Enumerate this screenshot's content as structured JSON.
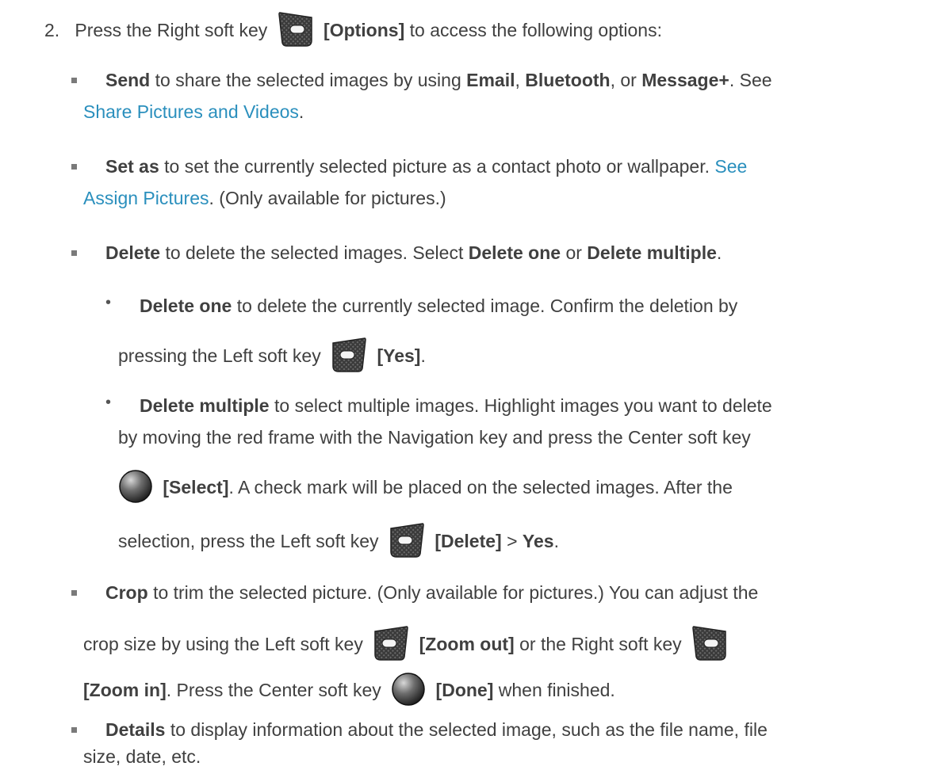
{
  "step": {
    "number": "2.",
    "t1": "Press the Right soft key",
    "label": "[Options]",
    "t2": "to access the following options:"
  },
  "send": {
    "label": "Send",
    "t1": "to share the selected images by using",
    "email": "Email",
    "t2": ",",
    "bluetooth": "Bluetooth",
    "t3": ", or",
    "message": "Message+",
    "t4": ". See",
    "link": "Share Pictures and Videos",
    "t5": "."
  },
  "setas": {
    "label": "Set as",
    "t1": "to set the currently selected picture as a contact photo or wallpaper.",
    "link1": "See",
    "link2": "Assign Pictures",
    "t2": ". (Only available for pictures.)"
  },
  "delete": {
    "label": "Delete",
    "t1": "to delete the selected images. Select",
    "one": "Delete one",
    "t2": "or",
    "multiple": "Delete multiple",
    "t3": "."
  },
  "delete_one": {
    "label": "Delete one",
    "t1": "to delete the currently selected image. Confirm the deletion by",
    "t2": "pressing the Left soft key",
    "key_label": "[Yes]",
    "t3": "."
  },
  "delete_multiple": {
    "label": "Delete multiple",
    "t1": "to select multiple images. Highlight images you want to delete",
    "t2": "by moving the red frame with the Navigation key and press the Center soft key",
    "select_label": "[Select]",
    "t3": ". A check mark will be placed on the selected images. After the",
    "t4": "selection, press the Left soft key",
    "delete_label": "[Delete]",
    "t5": ">",
    "yes": "Yes",
    "t6": "."
  },
  "crop": {
    "label": "Crop",
    "t1": "to trim the selected picture. (Only available for pictures.) You can adjust the",
    "t2": "crop size by using the Left soft key",
    "zoom_out": "[Zoom out]",
    "t3": "or the Right soft key",
    "zoom_in": "[Zoom in]",
    "t4": ". Press the Center soft key",
    "done": "[Done]",
    "t5": "when finished."
  },
  "details": {
    "label": "Details",
    "t1": "to display information about the selected image, such as the file name, file",
    "t2": "size, date, etc."
  },
  "icons": {
    "left_soft_key": "left-soft-key-icon",
    "right_soft_key": "right-soft-key-icon",
    "center_key": "center-key-icon"
  }
}
